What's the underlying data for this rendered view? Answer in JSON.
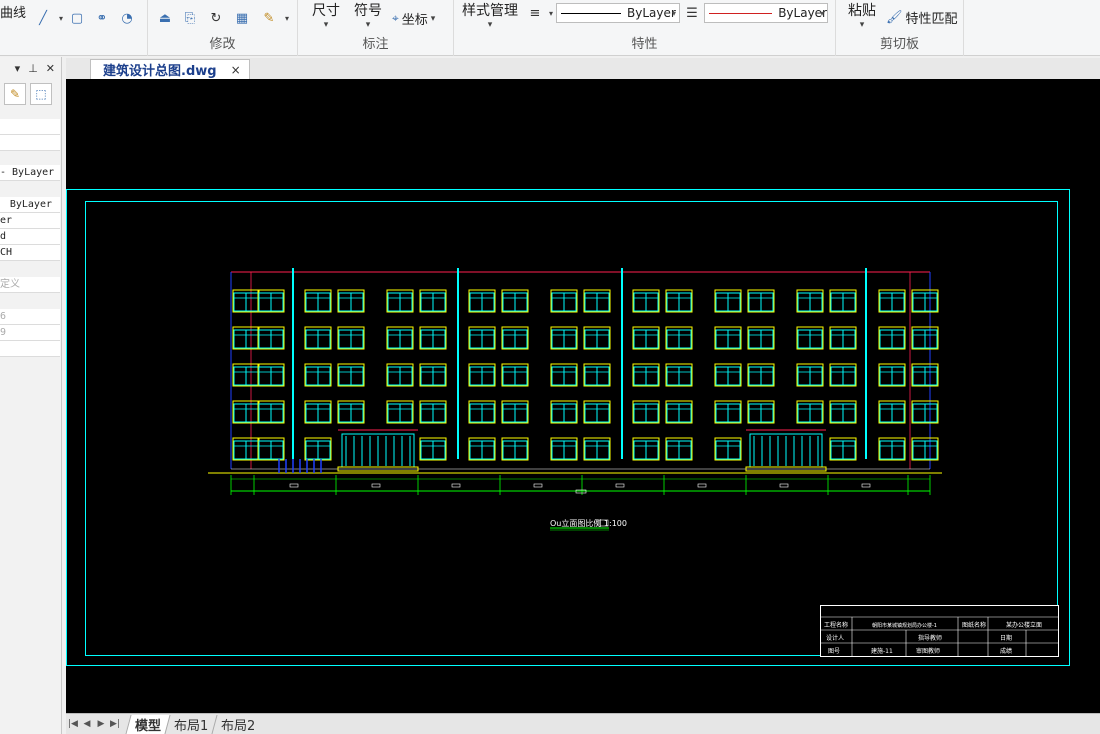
{
  "ribbon": {
    "curve_label": "曲线",
    "modify_label": "修改",
    "dimension_label": "尺寸",
    "symbol_label": "符号",
    "coordinate_label": "坐标",
    "annotation_label": "标注",
    "style_manager_label": "样式管理",
    "linetype_value": "ByLayer",
    "color_value": "ByLayer",
    "properties_label": "特性",
    "paste_label": "粘贴",
    "match_properties_label": "特性匹配",
    "clipboard_label": "剪切板"
  },
  "palette": {
    "rows": [
      "- ByLayer",
      "ByLayer",
      "er",
      "d",
      "CH",
      "定义",
      "6",
      "9"
    ]
  },
  "document": {
    "tab_title": "建筑设计总图.dwg",
    "close_symbol": "×"
  },
  "drawing": {
    "title_label": "Ou立面图比例 1:100",
    "titleblock": {
      "r1": [
        "工程名称",
        "朝阳市某城镇规划局办公楼-1",
        "图纸名称",
        "某办公楼立面"
      ],
      "r2": [
        "设计人",
        "",
        "指导教师",
        "",
        "日期",
        ""
      ],
      "r3": [
        "图号",
        "建施-11",
        "审图教师",
        "",
        "成绩",
        ""
      ]
    }
  },
  "layouts": {
    "tabs": [
      "模型",
      "布局1",
      "布局2"
    ]
  },
  "colors": {
    "cyan": "#00ffff",
    "yellow": "#ffff00",
    "green": "#00ff00",
    "red": "#ff2050",
    "blue": "#2040ff",
    "white": "#ffffff"
  }
}
